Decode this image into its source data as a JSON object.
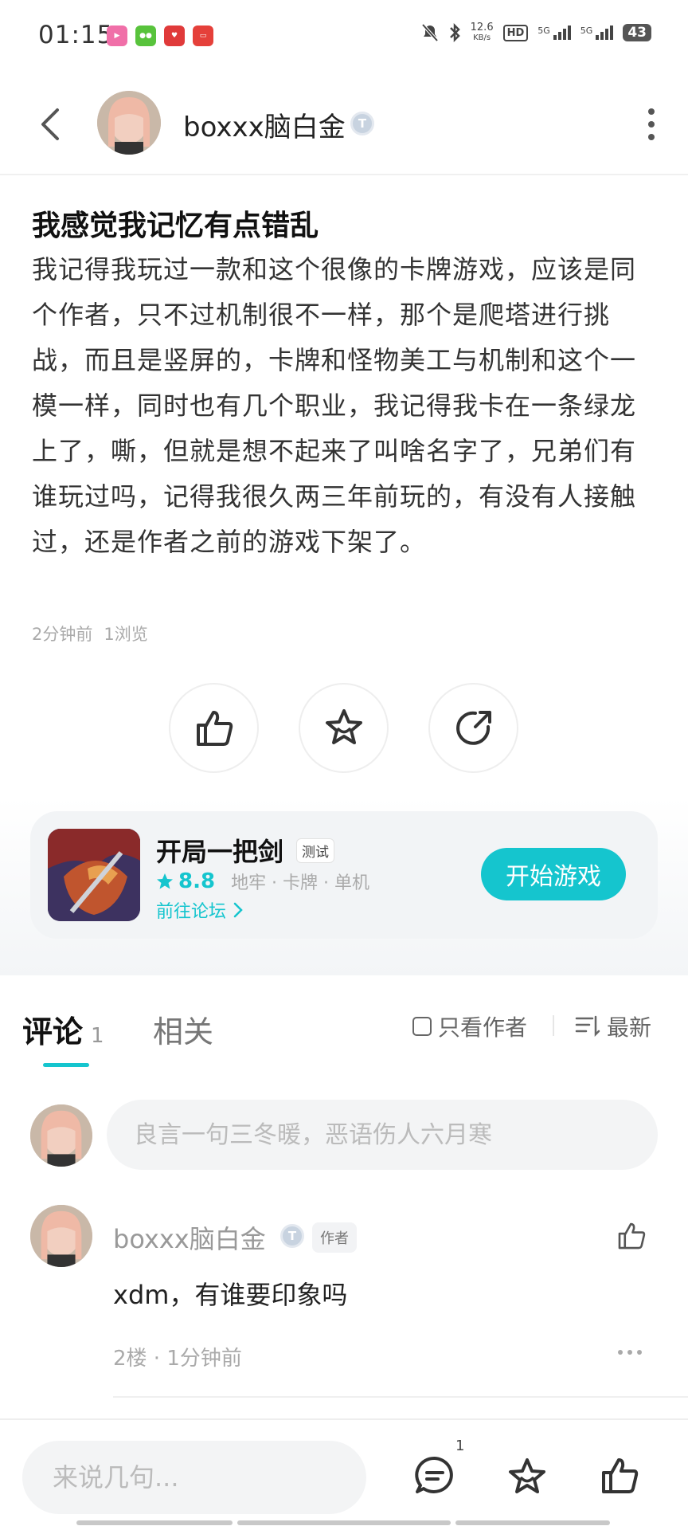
{
  "status_bar": {
    "time": "01:15",
    "net_speed": "12.6",
    "net_unit": "KB/s",
    "hd_label": "HD",
    "signal1": "5G",
    "signal2": "5G",
    "battery": "43"
  },
  "header": {
    "username": "boxxx脑白金",
    "level_badge": "T"
  },
  "post": {
    "title": "我感觉我记忆有点错乱",
    "body": "我记得我玩过一款和这个很像的卡牌游戏，应该是同个作者，只不过机制很不一样，那个是爬塔进行挑战，而且是竖屏的，卡牌和怪物美工与机制和这个一模一样，同时也有几个职业，我记得我卡在一条绿龙上了，嘶，但就是想不起来了叫啥名字了，兄弟们有谁玩过吗，记得我很久两三年前玩的，有没有人接触过，还是作者之前的游戏下架了。",
    "time_ago": "2分钟前",
    "views": "1浏览"
  },
  "game_card": {
    "name": "开局一把剑",
    "tag": "测试",
    "rating": "8.8",
    "tags": "地牢 · 卡牌 · 单机",
    "forum_link": "前往论坛",
    "play_button": "开始游戏"
  },
  "tabs": {
    "comments_label": "评论",
    "comments_count": "1",
    "related_label": "相关",
    "only_author": "只看作者",
    "sort_label": "最新"
  },
  "compose": {
    "placeholder": "良言一句三冬暖，恶语伤人六月寒"
  },
  "comments": [
    {
      "username": "boxxx脑白金",
      "level_badge": "T",
      "author_tag": "作者",
      "text": "xdm，有谁要印象吗",
      "meta": "2楼 · 1分钟前"
    }
  ],
  "bottom_bar": {
    "placeholder": "来说几句...",
    "comment_count": "1"
  },
  "colors": {
    "accent": "#15c5ce",
    "text_primary": "#222222",
    "text_muted": "#aaaaaa"
  }
}
